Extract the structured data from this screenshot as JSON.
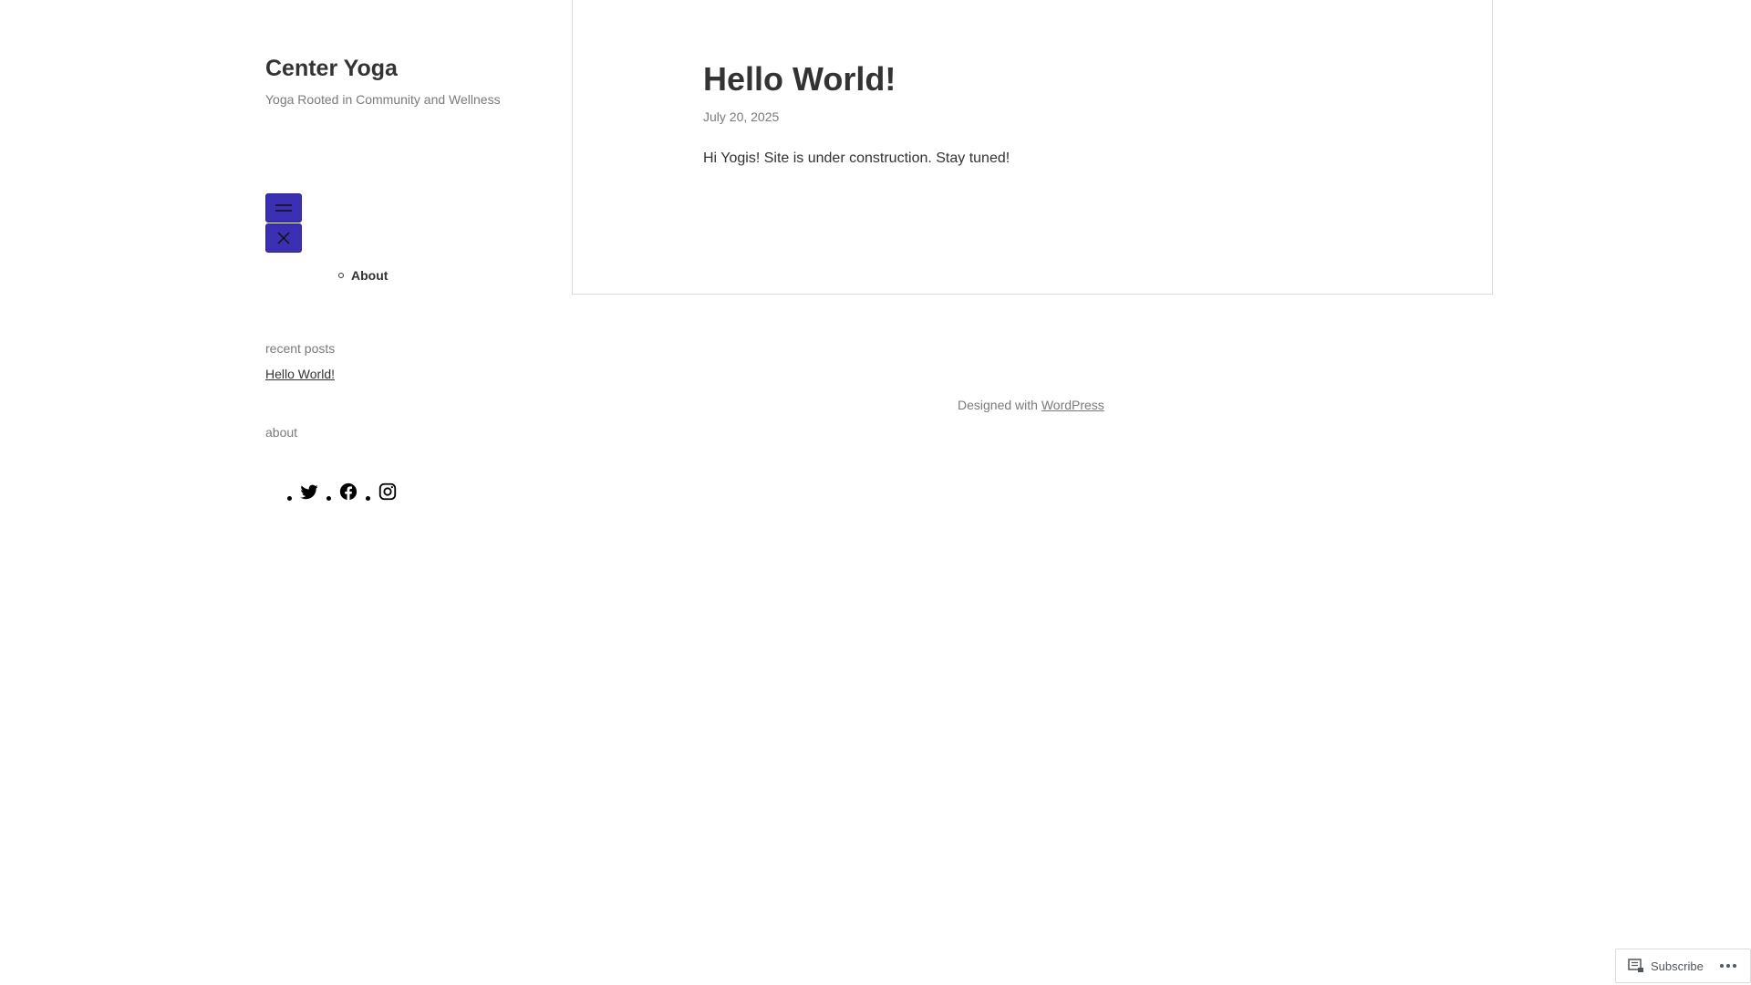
{
  "site": {
    "title": "Center Yoga",
    "tagline": "Yoga Rooted in Community and Wellness"
  },
  "nav": {
    "menu_icon": "hamburger-icon",
    "close_icon": "close-icon",
    "items": [
      {
        "label": "About"
      }
    ]
  },
  "widgets": {
    "recent_posts_title": "recent posts",
    "recent_posts": [
      {
        "label": "Hello World!"
      }
    ],
    "about_title": "about",
    "social": [
      "twitter-icon",
      "facebook-icon",
      "instagram-icon"
    ]
  },
  "post": {
    "title": "Hello World!",
    "date": "July 20, 2025",
    "body": "Hi Yogis! Site is under construction. Stay tuned!"
  },
  "footer": {
    "prefix": "Designed with ",
    "link": "WordPress"
  },
  "subscribe": {
    "label": "Subscribe",
    "more_icon": "ellipsis-icon"
  },
  "colors": {
    "accent": "#3b2fb3",
    "text": "#333333",
    "muted": "#7a7a7a"
  }
}
